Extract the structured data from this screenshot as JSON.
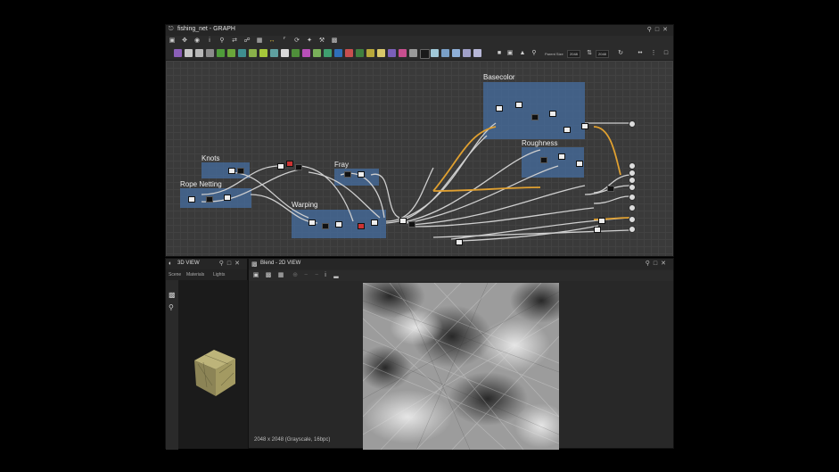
{
  "graph": {
    "title": "fishing_net - GRAPH",
    "parent_size_label": "Parent Size",
    "parent_size_value": "2048",
    "size_value": "2048",
    "frames": {
      "basecolor": "Basecolor",
      "roughness": "Roughness",
      "knots": "Knots",
      "rope_netting": "Rope Netting",
      "fray": "Fray",
      "warping": "Warping"
    },
    "palette": [
      "#8b5fb8",
      "#c8c8c8",
      "#4f9c3a",
      "#6aa63a",
      "#3f8f8f",
      "#b84fb8",
      "#b8a83a",
      "#2f6fb8",
      "#c84f4f",
      "#a0c8d8"
    ]
  },
  "view3d": {
    "title": "3D VIEW",
    "tabs": [
      "Scene",
      "Materials",
      "Lights"
    ]
  },
  "view2d": {
    "title": "Blend - 2D VIEW",
    "status": "2048 x 2048 (Grayscale, 16bpc)"
  }
}
